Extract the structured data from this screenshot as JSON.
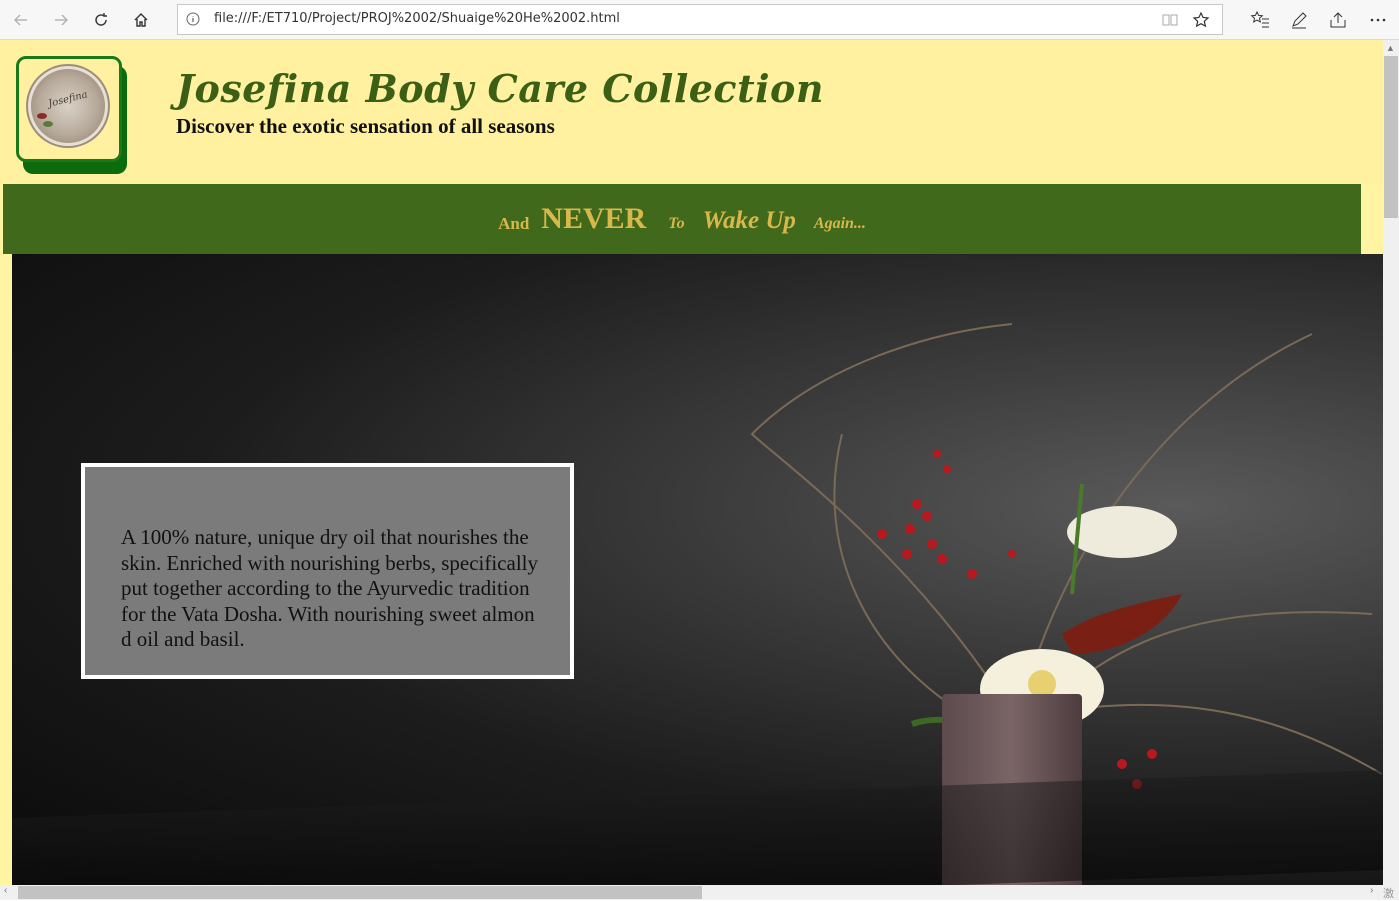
{
  "browser": {
    "url": "file:///F:/ET710/Project/PROJ%2002/Shuaige%20He%2002.html"
  },
  "header": {
    "title": "Josefina Body Care Collection",
    "subtitle": "Discover the exotic sensation of all seasons",
    "logo_text": "Josefina"
  },
  "banner": {
    "word1": "And",
    "word2": "NEVER",
    "word3": "To",
    "word4": "Wake Up",
    "word5": "Again..."
  },
  "hero": {
    "description": "A 100% nature, unique dry oil that nourishes the skin. Enriched with nourishing berbs, specifically put together according to the Ayurvedic tradition for the Vata Dosha. With nourishing sweet almond oil and basil."
  },
  "corner_glyph": "激",
  "colors": {
    "header_bg": "#fff1a0",
    "banner_bg": "#41691b",
    "banner_text": "#d8b84a",
    "title": "#3a5f15",
    "logo_border": "#1a7a1a",
    "card_bg": "#7b7b7b"
  }
}
